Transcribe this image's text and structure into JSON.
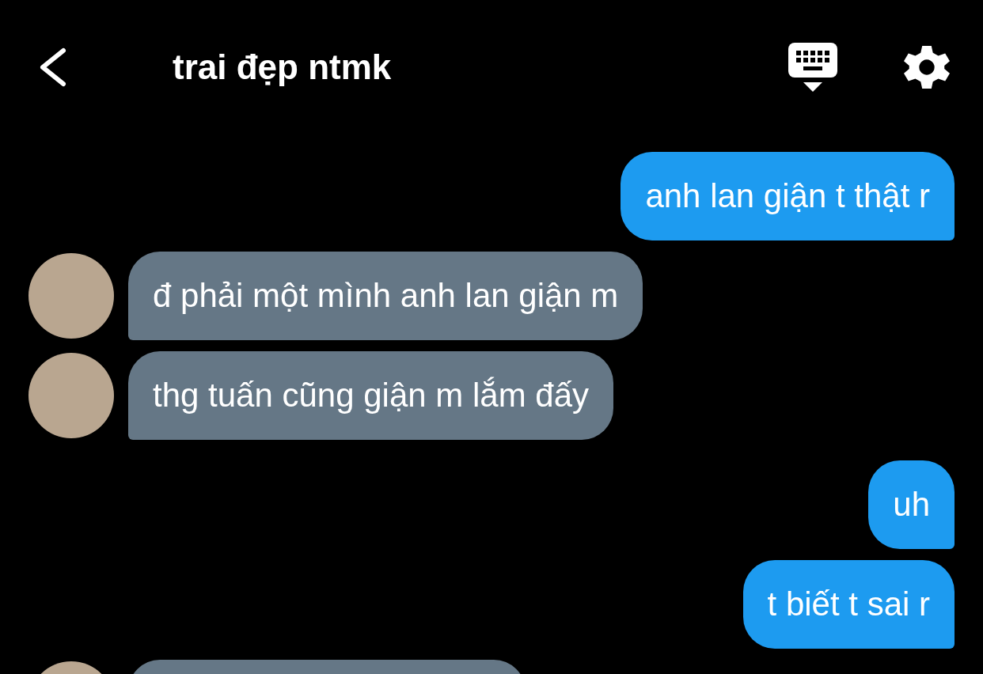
{
  "header": {
    "title": "trai đẹp ntmk"
  },
  "messages": [
    {
      "kind": "out",
      "text": "anh lan giận t thật r"
    },
    {
      "kind": "in",
      "text": "đ phải một mình anh lan giận m"
    },
    {
      "kind": "in",
      "text": "thg tuấn cũng giận m lắm đấy"
    },
    {
      "kind": "out",
      "text": "uh"
    },
    {
      "kind": "out",
      "text": "t biết t sai r"
    },
    {
      "kind": "in"
    }
  ]
}
